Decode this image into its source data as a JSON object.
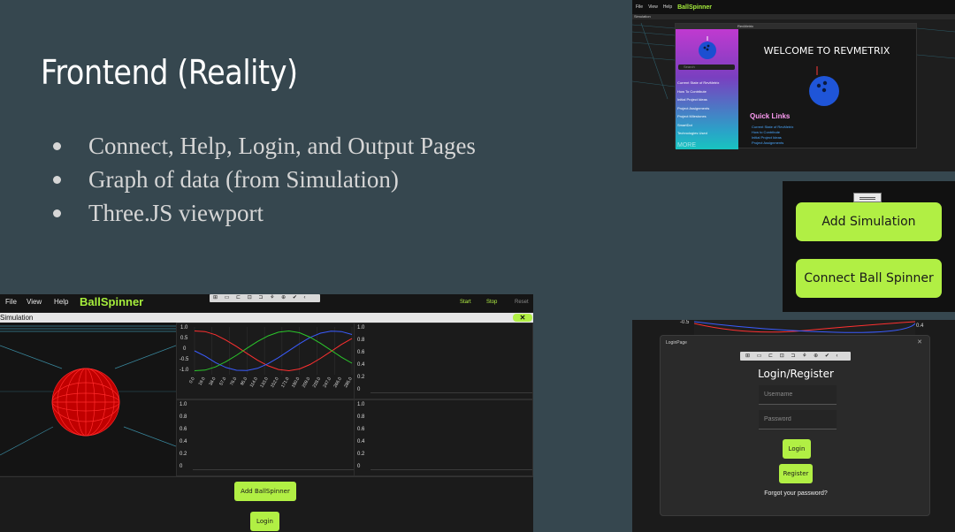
{
  "slide": {
    "title": "Frontend (Reality)",
    "bullets": [
      "Connect, Help, Login, and Output Pages",
      "Graph of data (from Simulation)",
      "Three.JS viewport"
    ]
  },
  "welcome_window": {
    "window_title": "RevMetrix",
    "search_placeholder": "Search",
    "sidebar_items": [
      "Current State of RevMetrix",
      "How To Contribute",
      "Initial Project Ideas",
      "Project Assignments",
      "Project Milestones",
      "SmartDot",
      "Technologies Used"
    ],
    "more_label": "MORE",
    "heading": "WELCOME TO REVMETRIX",
    "quick_links_label": "Quick Links",
    "quick_links": [
      "Current State of RevMetrix",
      "How to Contribute",
      "Initial Project Ideas",
      "Project Assignments"
    ]
  },
  "button_panel": {
    "add_simulation": "Add Simulation",
    "connect_ball_spinner": "Connect Ball Spinner"
  },
  "ballspinner_app": {
    "menu": {
      "file": "File",
      "view": "View",
      "help": "Help"
    },
    "brand": "BallSpinner",
    "controls": {
      "start": "Start",
      "stop": "Stop",
      "reset": "Reset"
    },
    "sim_tab": "Simulation",
    "close_symbol": "✕",
    "chart_main": {
      "y_ticks": [
        "1.0",
        "0.5",
        "0",
        "-0.5",
        "-1.0"
      ],
      "x_ticks": [
        "0.0",
        "19.0",
        "38.0",
        "57.0",
        "76.0",
        "95.0",
        "114.0",
        "133.0",
        "152.0",
        "171.0",
        "190.0",
        "209.0",
        "228.0",
        "247.0",
        "266.0",
        "285.0"
      ]
    },
    "empty_y_ticks": [
      "1.0",
      "0.8",
      "0.6",
      "0.4",
      "0.2",
      "0"
    ],
    "add_ballspinner": "Add BallSpinner",
    "login": "Login"
  },
  "chart_data": {
    "type": "line",
    "x": [
      0,
      19,
      38,
      57,
      76,
      95,
      114,
      133,
      152,
      171,
      190,
      209,
      228,
      247,
      266,
      285
    ],
    "series": [
      {
        "color": "#ff3030",
        "values": [
          1.0,
          0.97,
          0.81,
          0.54,
          0.22,
          -0.13,
          -0.47,
          -0.75,
          -0.94,
          -1.0,
          -0.91,
          -0.69,
          -0.38,
          -0.03,
          0.32,
          0.62
        ]
      },
      {
        "color": "#3a5cff",
        "values": [
          0.0,
          -0.26,
          -0.59,
          -0.84,
          -0.98,
          -0.99,
          -0.88,
          -0.65,
          -0.34,
          0.01,
          0.36,
          0.67,
          0.89,
          0.99,
          0.97,
          0.82
        ]
      },
      {
        "color": "#2bc72b",
        "values": [
          -1.0,
          -0.97,
          -0.81,
          -0.54,
          -0.22,
          0.13,
          0.47,
          0.75,
          0.94,
          1.0,
          0.91,
          0.69,
          0.38,
          0.03,
          -0.32,
          -0.62
        ]
      }
    ],
    "ylim": [
      -1.2,
      1.2
    ]
  },
  "login_window": {
    "window_title": "LoginPage",
    "close_symbol": "✕",
    "heading": "Login/Register",
    "username_placeholder": "Username",
    "password_placeholder": "Password",
    "login": "Login",
    "register": "Register",
    "forgot": "Forgot your password?",
    "bg_ticks": [
      "-0.5",
      "0.4"
    ]
  },
  "colors": {
    "accent": "#b1ef44",
    "slide_bg": "#36474f"
  }
}
